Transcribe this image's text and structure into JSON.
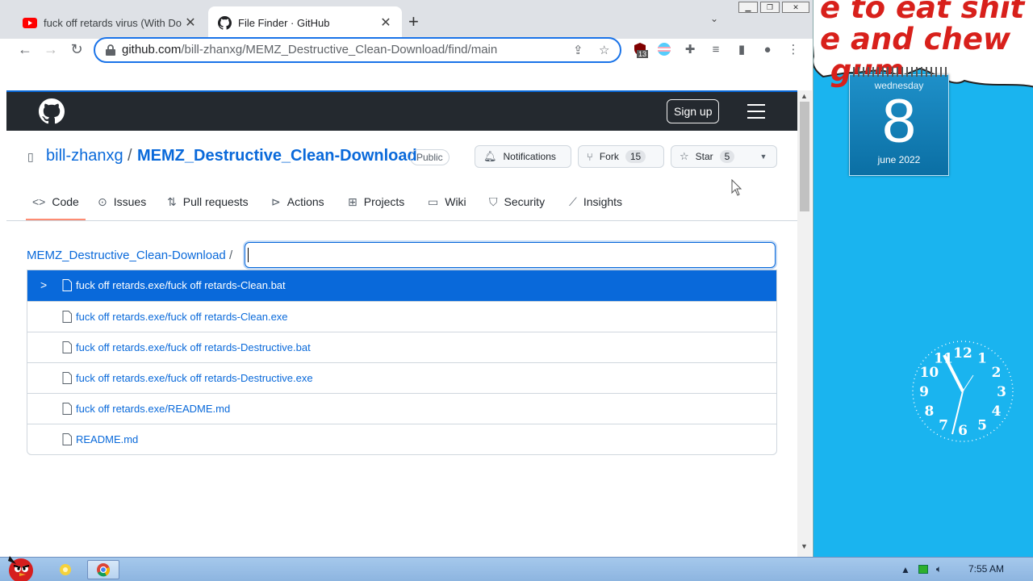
{
  "desktop": {
    "speech_text": "e to eat shit\ne and chew\n gum",
    "calendar": {
      "weekday": "wednesday",
      "day": "8",
      "month_year": "june 2022"
    },
    "clock": {
      "numerals": [
        "12",
        "1",
        "2",
        "3",
        "4",
        "5",
        "6",
        "7",
        "8",
        "9",
        "10",
        "11"
      ]
    }
  },
  "browser": {
    "tabs": [
      {
        "title": "fuck off retards virus (With Do",
        "icon": "youtube-icon"
      },
      {
        "title": "File Finder · GitHub",
        "icon": "github-icon"
      }
    ],
    "new_tab_label": "+",
    "address": {
      "host": "github.com",
      "path": "/bill-zhanxg/MEMZ_Destructive_Clean-Download/find/main"
    },
    "extension_badge": "13"
  },
  "github": {
    "signup_label": "Sign up",
    "repo": {
      "owner": "bill-zhanxg",
      "separator": "/",
      "name": "MEMZ_Destructive_Clean-Download",
      "visibility": "Public"
    },
    "actions": {
      "notifications_label": "Notifications",
      "fork_label": "Fork",
      "fork_count": "15",
      "star_label": "Star",
      "star_count": "5"
    },
    "nav": [
      {
        "label": "Code",
        "icon": "code-icon"
      },
      {
        "label": "Issues",
        "icon": "issue-icon"
      },
      {
        "label": "Pull requests",
        "icon": "pull-request-icon"
      },
      {
        "label": "Actions",
        "icon": "play-icon"
      },
      {
        "label": "Projects",
        "icon": "table-icon"
      },
      {
        "label": "Wiki",
        "icon": "book-icon"
      },
      {
        "label": "Security",
        "icon": "shield-icon"
      },
      {
        "label": "Insights",
        "icon": "graph-icon"
      }
    ],
    "finder": {
      "breadcrumb": "MEMZ_Destructive_Clean-Download",
      "breadcrumb_sep": "/",
      "query": ""
    },
    "results": [
      "fuck off retards.exe/fuck off retards-Clean.bat",
      "fuck off retards.exe/fuck off retards-Clean.exe",
      "fuck off retards.exe/fuck off retards-Destructive.bat",
      "fuck off retards.exe/fuck off retards-Destructive.exe",
      "fuck off retards.exe/README.md",
      "README.md"
    ]
  },
  "taskbar": {
    "time": "7:55 AM"
  },
  "colors": {
    "accent": "#0969da",
    "header": "#24292f",
    "desktop": "#1ab4ef",
    "selected_underline": "#fd8c73"
  }
}
